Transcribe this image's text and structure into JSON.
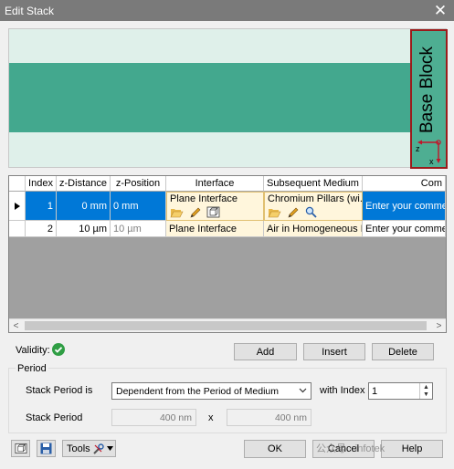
{
  "window": {
    "title": "Edit Stack",
    "close_icon": "close-icon"
  },
  "preview": {
    "base_block_label": "Base Block",
    "axis_z": "z",
    "axis_x": "x",
    "colors": {
      "background": "#dff0ea",
      "layer": "#43a88e",
      "base_block": "#4eae92",
      "base_block_border": "#9b1b1b"
    }
  },
  "table": {
    "columns": [
      "Index",
      "z-Distance",
      "z-Position",
      "Interface",
      "Subsequent Medium",
      "Com"
    ],
    "rows": [
      {
        "index": "1",
        "z_distance": "0 mm",
        "z_position": "0 mm",
        "interface": "Plane Interface",
        "medium": "Chromium Pillars (wi...",
        "comment": "Enter your comment",
        "selected": true
      },
      {
        "index": "2",
        "z_distance": "10 µm",
        "z_position": "10 µm",
        "interface": "Plane Interface",
        "medium": "Air in Homogeneous M",
        "comment": "Enter your comment",
        "selected": false
      }
    ],
    "selection_color": "#0078d7"
  },
  "validity": {
    "label": "Validity:",
    "status_icon": "check-circle-icon"
  },
  "actions": {
    "add": "Add",
    "insert": "Insert",
    "delete": "Delete"
  },
  "period": {
    "group_label": "Period",
    "stack_period_is_label": "Stack Period is",
    "stack_period_is_value": "Dependent from the Period of Medium",
    "with_index_label": "with Index",
    "with_index_value": "1",
    "stack_period_label": "Stack Period",
    "period_x": "400 nm",
    "times": "x",
    "period_y": "400 nm"
  },
  "footer": {
    "tools_label": "Tools",
    "ok": "OK",
    "cancel": "Cancel",
    "help": "Help",
    "watermark": "公众号 · infotek"
  }
}
